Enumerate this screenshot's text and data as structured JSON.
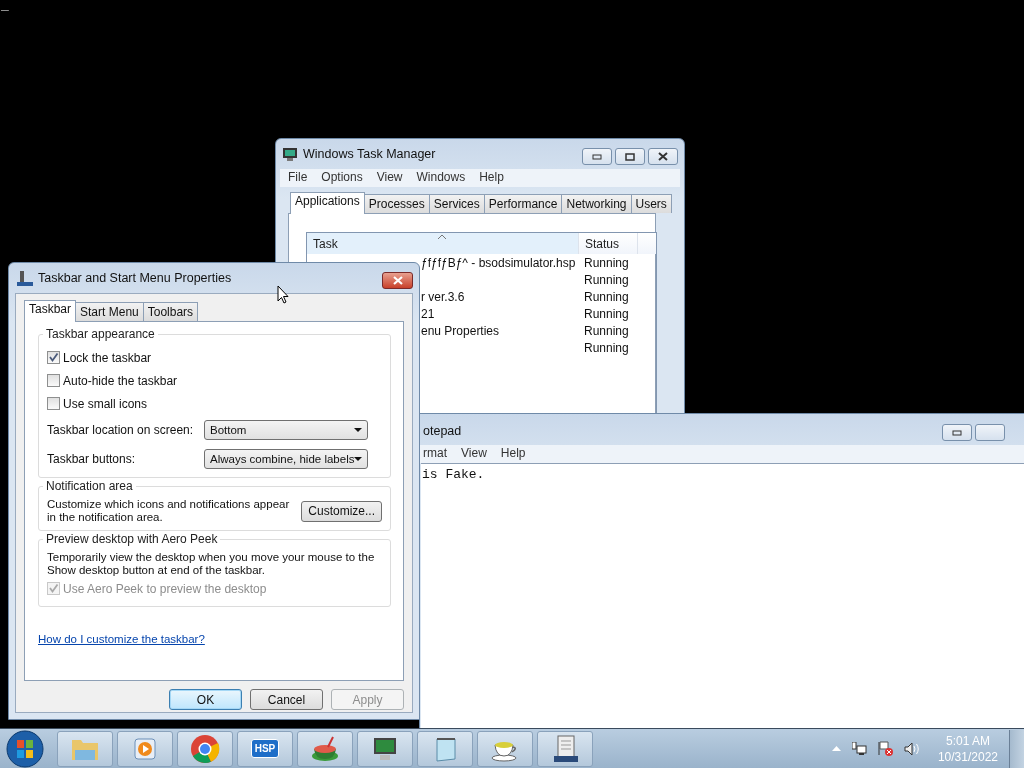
{
  "desktop": {
    "cursor": "_"
  },
  "task_manager": {
    "title": "Windows Task Manager",
    "menu": [
      "File",
      "Options",
      "View",
      "Windows",
      "Help"
    ],
    "tabs": [
      {
        "label": "Applications",
        "selected": true
      },
      {
        "label": "Processes",
        "selected": false
      },
      {
        "label": "Services",
        "selected": false
      },
      {
        "label": "Performance",
        "selected": false
      },
      {
        "label": "Networking",
        "selected": false
      },
      {
        "label": "Users",
        "selected": false
      }
    ],
    "columns": [
      "Task",
      "Status"
    ],
    "rows": [
      {
        "task": "ƒfƒfƒBƒ^ - bsodsimulator.hsp",
        "status": "Running"
      },
      {
        "task": "",
        "status": "Running"
      },
      {
        "task": "r ver.3.6",
        "status": "Running"
      },
      {
        "task": "21",
        "status": "Running"
      },
      {
        "task": "enu Properties",
        "status": "Running"
      },
      {
        "task": "",
        "status": "Running"
      }
    ]
  },
  "notepad": {
    "title": "otepad",
    "menu": [
      "rmat",
      "View",
      "Help"
    ],
    "text": "is Fake."
  },
  "dialog": {
    "title": "Taskbar and Start Menu Properties",
    "tabs": [
      {
        "label": "Taskbar",
        "selected": true
      },
      {
        "label": "Start Menu",
        "selected": false
      },
      {
        "label": "Toolbars",
        "selected": false
      }
    ],
    "appearance": {
      "title": "Taskbar appearance",
      "checkboxes": [
        {
          "label": "Lock the taskbar",
          "checked": true
        },
        {
          "label": "Auto-hide the taskbar",
          "checked": false
        },
        {
          "label": "Use small icons",
          "checked": false
        }
      ],
      "selects": [
        {
          "label": "Taskbar location on screen:",
          "value": "Bottom"
        },
        {
          "label": "Taskbar buttons:",
          "value": "Always combine, hide labels"
        }
      ]
    },
    "notification": {
      "title": "Notification area",
      "text": "Customize which icons and notifications appear in the notification area.",
      "button": "Customize..."
    },
    "peek": {
      "title": "Preview desktop with Aero Peek",
      "text": "Temporarily view the desktop when you move your mouse to the Show desktop button at end of the taskbar.",
      "checkbox": {
        "label": "Use Aero Peek to preview the desktop",
        "checked": true,
        "disabled": true
      }
    },
    "link": "How do I customize the taskbar?",
    "buttons": [
      {
        "label": "OK",
        "default": true,
        "disabled": false
      },
      {
        "label": "Cancel",
        "default": false,
        "disabled": false
      },
      {
        "label": "Apply",
        "default": false,
        "disabled": true
      }
    ]
  },
  "taskbar": {
    "apps": [
      {
        "kind": "folder"
      },
      {
        "kind": "media"
      },
      {
        "kind": "chrome"
      },
      {
        "kind": "hsp",
        "label": "HSP"
      },
      {
        "kind": "bowl"
      },
      {
        "kind": "monitor"
      },
      {
        "kind": "notepad"
      },
      {
        "kind": "teacup"
      },
      {
        "kind": "server"
      }
    ],
    "time": "5:01 AM",
    "date": "10/31/2022"
  }
}
